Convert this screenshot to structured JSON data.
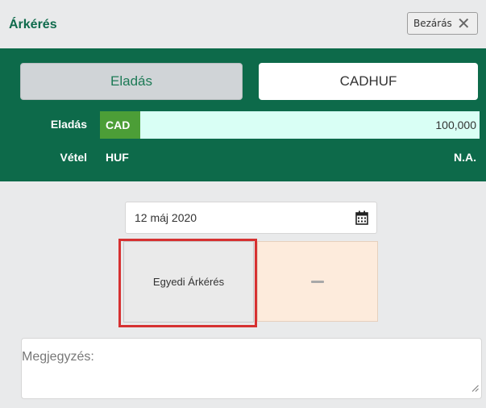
{
  "header": {
    "title": "Árkérés",
    "close_label": "Bezárás"
  },
  "tabs": {
    "side_label": "Eladás",
    "pair": "CADHUF"
  },
  "sell_row": {
    "label": "Eladás",
    "currency": "CAD",
    "amount": "100,000"
  },
  "buy_row": {
    "label": "Vétel",
    "currency": "HUF",
    "value": "N.A."
  },
  "date": {
    "value": "12 máj 2020"
  },
  "quote": {
    "button_label": "Egyedi Árkérés",
    "price": "–"
  },
  "note": {
    "placeholder": "Megjegyzés:"
  },
  "icons": {
    "close": "close-icon",
    "calendar": "calendar-icon",
    "resize": "resize-handle-icon"
  },
  "colors": {
    "brand_green": "#0d6a4a",
    "accent_green": "#4c9e37",
    "amount_bg": "#d9fff5",
    "price_bg": "#fdebdc",
    "highlight": "#d63131"
  }
}
